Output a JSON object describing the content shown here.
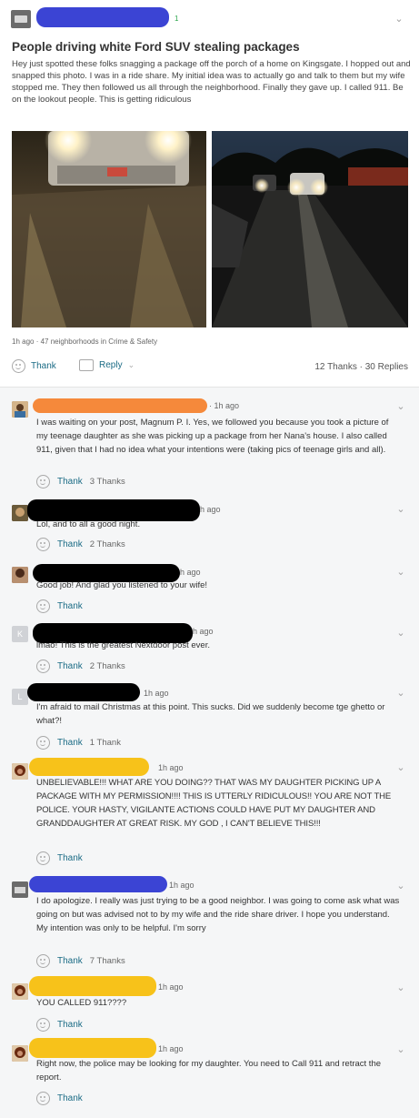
{
  "post": {
    "badge": "1",
    "title": "People driving white Ford SUV stealing packages",
    "body": "Hey just spotted these folks snagging a package off the porch of a home on Kingsgate. I hopped out and snapped this photo. I was in a ride share. My initial idea was to actually go and talk to them but my wife stopped me. They then followed us all through the neighborhood. Finally they gave up. I called 911. Be on the lookout people. This is getting ridiculous",
    "meta": "1h ago · 47 neighborhoods in Crime & Safety",
    "thank_label": "Thank",
    "reply_label": "Reply",
    "counts": "12 Thanks · 30 Replies",
    "redaction_color": "#3b44d4"
  },
  "comments": [
    {
      "time": "· 1h ago",
      "text": "I was waiting on your post, Magnum P. I. Yes, we followed you because you took a picture of my teenage daughter as she was picking up a package from her Nana's house. I also called 911, given that I had no idea what your intentions were (taking pics of teenage girls and all).",
      "thank": "Thank",
      "thanks": "3 Thanks",
      "redaction_color": "#f5893b"
    },
    {
      "time": "h ago",
      "text": "Lol, and to all a good night.",
      "thank": "Thank",
      "thanks": "2 Thanks",
      "redaction_color": "#000000"
    },
    {
      "time": "h ago",
      "text": "Good job! And glad you listened to your wife!",
      "thank": "Thank",
      "thanks": "",
      "redaction_color": "#000000"
    },
    {
      "time": "h ago",
      "avatar_letter": "K",
      "text": "lmao! This is the greatest Nextdoor post ever.",
      "thank": "Thank",
      "thanks": "2 Thanks",
      "redaction_color": "#000000"
    },
    {
      "time": "1h ago",
      "avatar_letter": "L",
      "text": "I'm afraid to mail Christmas at this point. This sucks. Did we suddenly become tge ghetto or what?!",
      "thank": "Thank",
      "thanks": "1 Thank",
      "redaction_color": "#000000"
    },
    {
      "time": "1h ago",
      "text": "UNBELIEVABLE!!!  WHAT ARE YOU DOING?? THAT WAS MY DAUGHTER PICKING UP A PACKAGE WITH MY PERMISSION!!!! THIS IS UTTERLY RIDICULOUS!!  YOU ARE NOT THE POLICE. YOUR HASTY, VIGILANTE ACTIONS COULD HAVE PUT MY DAUGHTER AND GRANDDAUGHTER  AT GREAT RISK. MY GOD , I CAN'T BELIEVE THIS!!!",
      "thank": "Thank",
      "thanks": "",
      "redaction_color": "#f7c21a"
    },
    {
      "time": "1h ago",
      "text": "I do apologize. I really was just trying to be a good neighbor. I was going to come ask what was going on but was advised not to by my wife and the ride share driver. I hope you understand. My intention was only to be helpful. I'm sorry",
      "thank": "Thank",
      "thanks": "7 Thanks",
      "redaction_color": "#3b44d4"
    },
    {
      "time": "1h ago",
      "text": "YOU CALLED 911????",
      "thank": "Thank",
      "thanks": "",
      "redaction_color": "#f7c21a"
    },
    {
      "time": "1h ago",
      "text": "Right now, the police may be looking for my daughter.  You need to Call 911 and retract the report.",
      "thank": "Thank",
      "thanks": "",
      "redaction_color": "#f7c21a"
    }
  ]
}
